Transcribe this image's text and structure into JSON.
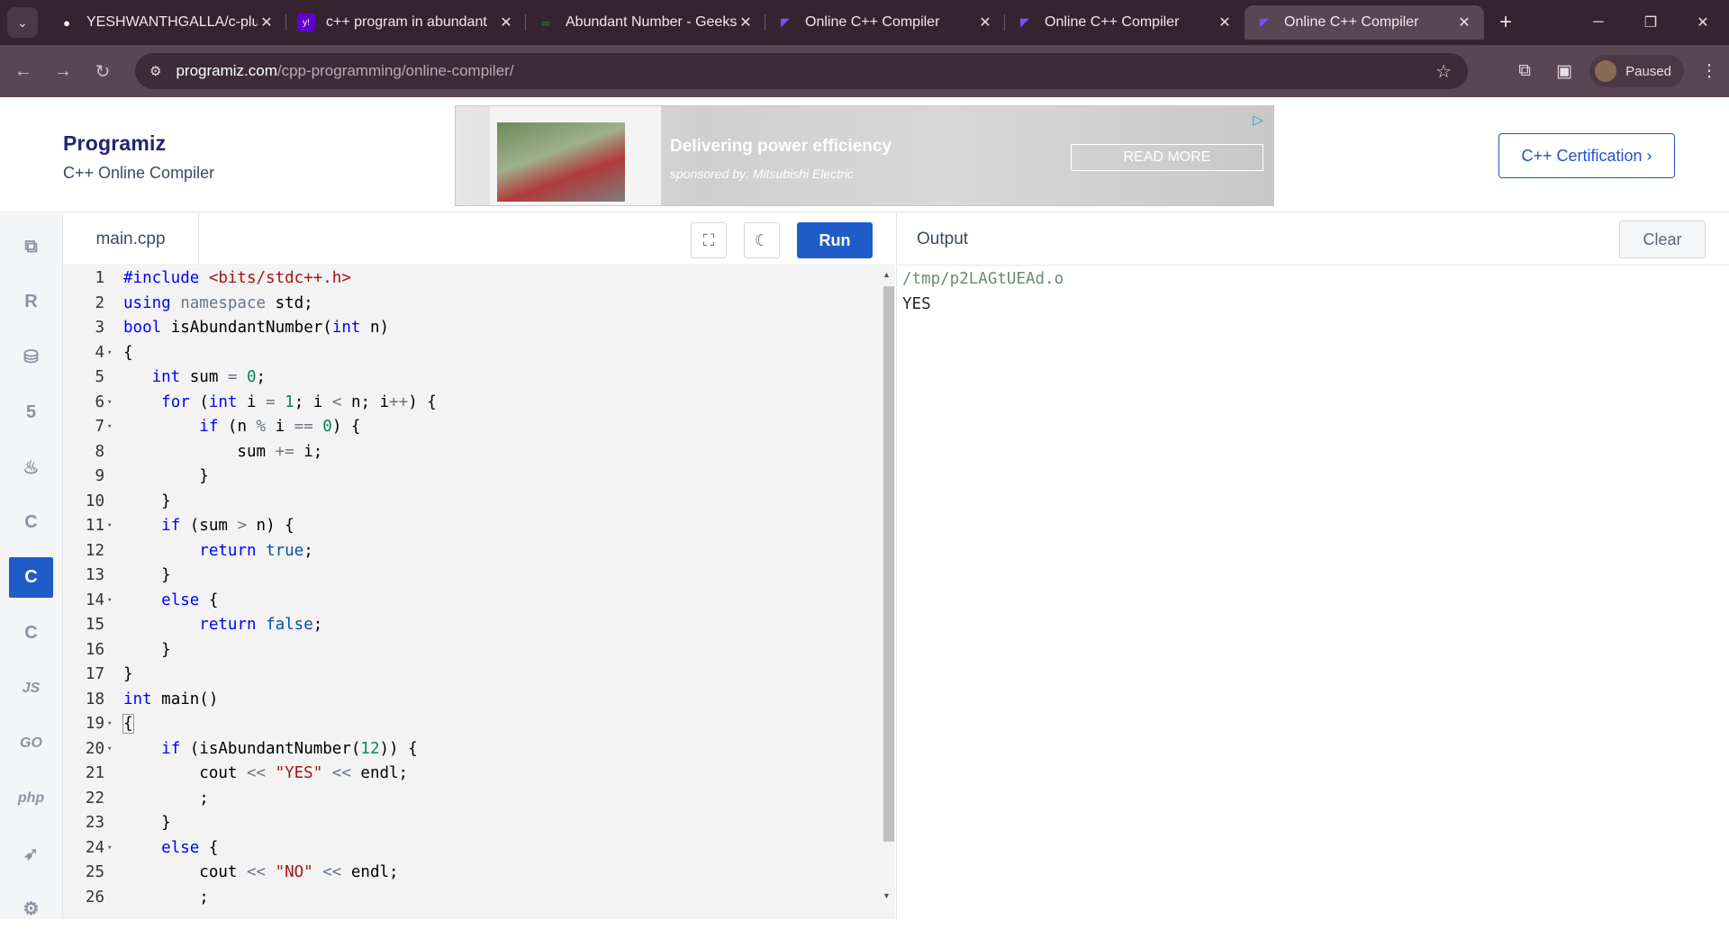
{
  "browser": {
    "tabs": [
      {
        "title": "YESHWANTHGALLA/c-plus",
        "icon": "github-icon"
      },
      {
        "title": "c++ program in abundant",
        "icon": "yahoo-icon"
      },
      {
        "title": "Abundant Number - Geeks",
        "icon": "geeksforgeeks-icon"
      },
      {
        "title": "Online C++ Compiler",
        "icon": "programiz-icon"
      },
      {
        "title": "Online C++ Compiler",
        "icon": "programiz-icon"
      },
      {
        "title": "Online C++ Compiler",
        "icon": "programiz-icon"
      }
    ],
    "active_tab_index": 5,
    "url_host": "programiz.com",
    "url_path": "/cpp-programming/online-compiler/",
    "profile_label": "Paused"
  },
  "header": {
    "logo_text": "Programiz",
    "subtitle": "C++ Online Compiler",
    "cert_button": "C++ Certification ›"
  },
  "ad": {
    "headline": "Delivering power efficiency",
    "sponsor": "sponsored by: Mitsubishi Electric",
    "button": "READ MORE"
  },
  "rail": {
    "items": [
      "python-icon",
      "r-icon",
      "sql-database-icon",
      "html5-icon",
      "java-icon",
      "c-icon",
      "cpp-icon",
      "csharp-icon",
      "JS",
      "GO",
      "php",
      "swift-icon",
      "rust-icon"
    ],
    "active_index": 6
  },
  "editor": {
    "file_name": "main.cpp",
    "run_label": "Run",
    "fold_lines": [
      4,
      6,
      7,
      11,
      14,
      19,
      20,
      24
    ],
    "lines": [
      [
        [
          "pp",
          "#include "
        ],
        [
          "str",
          "<bits/stdc++.h>"
        ]
      ],
      [
        [
          "kw",
          "using "
        ],
        [
          "op",
          "namespace "
        ],
        [
          "",
          "std;"
        ]
      ],
      [
        [
          "kw",
          "bool "
        ],
        [
          "",
          "isAbundantNumber("
        ],
        [
          "kw",
          "int "
        ],
        [
          "",
          "n)"
        ]
      ],
      [
        [
          "",
          "{"
        ]
      ],
      [
        [
          "",
          "   "
        ],
        [
          "kw",
          "int "
        ],
        [
          "",
          "sum "
        ],
        [
          "op",
          "= "
        ],
        [
          "num",
          "0"
        ],
        [
          "",
          "; "
        ]
      ],
      [
        [
          "",
          "    "
        ],
        [
          "kw",
          "for "
        ],
        [
          "",
          "("
        ],
        [
          "kw",
          "int "
        ],
        [
          "",
          "i "
        ],
        [
          "op",
          "= "
        ],
        [
          "num",
          "1"
        ],
        [
          "",
          "; i "
        ],
        [
          "op",
          "< "
        ],
        [
          "",
          "n; i"
        ],
        [
          "op",
          "++"
        ],
        [
          "",
          ") {"
        ]
      ],
      [
        [
          "",
          "        "
        ],
        [
          "kw",
          "if "
        ],
        [
          "",
          "(n "
        ],
        [
          "op",
          "% "
        ],
        [
          "",
          "i "
        ],
        [
          "op",
          "== "
        ],
        [
          "num",
          "0"
        ],
        [
          "",
          ") {"
        ]
      ],
      [
        [
          "",
          "            sum "
        ],
        [
          "op",
          "+= "
        ],
        [
          "",
          "i;"
        ]
      ],
      [
        [
          "",
          "        }"
        ]
      ],
      [
        [
          "",
          "    }"
        ]
      ],
      [
        [
          "",
          "    "
        ],
        [
          "kw",
          "if "
        ],
        [
          "",
          "(sum "
        ],
        [
          "op",
          "> "
        ],
        [
          "",
          "n) {"
        ]
      ],
      [
        [
          "",
          "        "
        ],
        [
          "kw",
          "return "
        ],
        [
          "lit",
          "true"
        ],
        [
          "",
          ";"
        ]
      ],
      [
        [
          "",
          "    }"
        ]
      ],
      [
        [
          "",
          "    "
        ],
        [
          "kw",
          "else "
        ],
        [
          "",
          "{"
        ]
      ],
      [
        [
          "",
          "        "
        ],
        [
          "kw",
          "return "
        ],
        [
          "lit",
          "false"
        ],
        [
          "",
          ";"
        ]
      ],
      [
        [
          "",
          "    }"
        ]
      ],
      [
        [
          "",
          "}"
        ]
      ],
      [
        [
          "kw",
          "int "
        ],
        [
          "",
          "main()"
        ]
      ],
      [
        [
          "",
          "{"
        ]
      ],
      [
        [
          "",
          "    "
        ],
        [
          "kw",
          "if "
        ],
        [
          "",
          "(isAbundantNumber("
        ],
        [
          "num",
          "12"
        ],
        [
          "",
          ")) {"
        ]
      ],
      [
        [
          "",
          "        cout "
        ],
        [
          "op",
          "<< "
        ],
        [
          "str",
          "\"YES\" "
        ],
        [
          "op",
          "<< "
        ],
        [
          "",
          "endl;"
        ]
      ],
      [
        [
          "",
          "        ;"
        ]
      ],
      [
        [
          "",
          "    }"
        ]
      ],
      [
        [
          "",
          "    "
        ],
        [
          "kw",
          "else "
        ],
        [
          "",
          "{"
        ]
      ],
      [
        [
          "",
          "        cout "
        ],
        [
          "op",
          "<< "
        ],
        [
          "str",
          "\"NO\" "
        ],
        [
          "op",
          "<< "
        ],
        [
          "",
          "endl;"
        ]
      ],
      [
        [
          "",
          "        ;"
        ]
      ]
    ]
  },
  "output": {
    "title": "Output",
    "clear_label": "Clear",
    "lines": [
      "/tmp/p2LAGtUEAd.o",
      "YES"
    ]
  }
}
